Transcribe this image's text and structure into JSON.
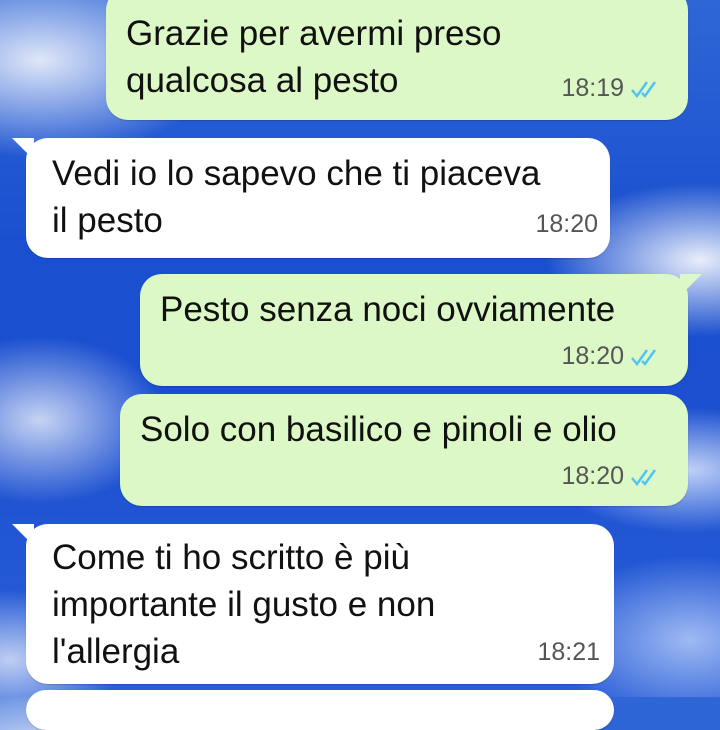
{
  "colors": {
    "sent_bubble": "#dcf8c6",
    "received_bubble": "#ffffff",
    "read_ticks": "#4fc3f7"
  },
  "messages": [
    {
      "direction": "sent",
      "text": "Grazie per avermi preso\nqualcosa al pesto",
      "time": "18:19",
      "status": "read-ticks-icon"
    },
    {
      "direction": "received",
      "text": "Vedi io lo sapevo che ti piaceva\nil pesto",
      "time": "18:20"
    },
    {
      "direction": "sent",
      "text": "Pesto senza noci ovviamente",
      "time": "18:20",
      "status": "read-ticks-icon"
    },
    {
      "direction": "sent",
      "text": "Solo con basilico e pinoli e olio",
      "time": "18:20",
      "status": "read-ticks-icon"
    },
    {
      "direction": "received",
      "text": "Come ti ho scritto è più\nimportante il gusto e non\nl'allergia",
      "time": "18:21"
    }
  ]
}
